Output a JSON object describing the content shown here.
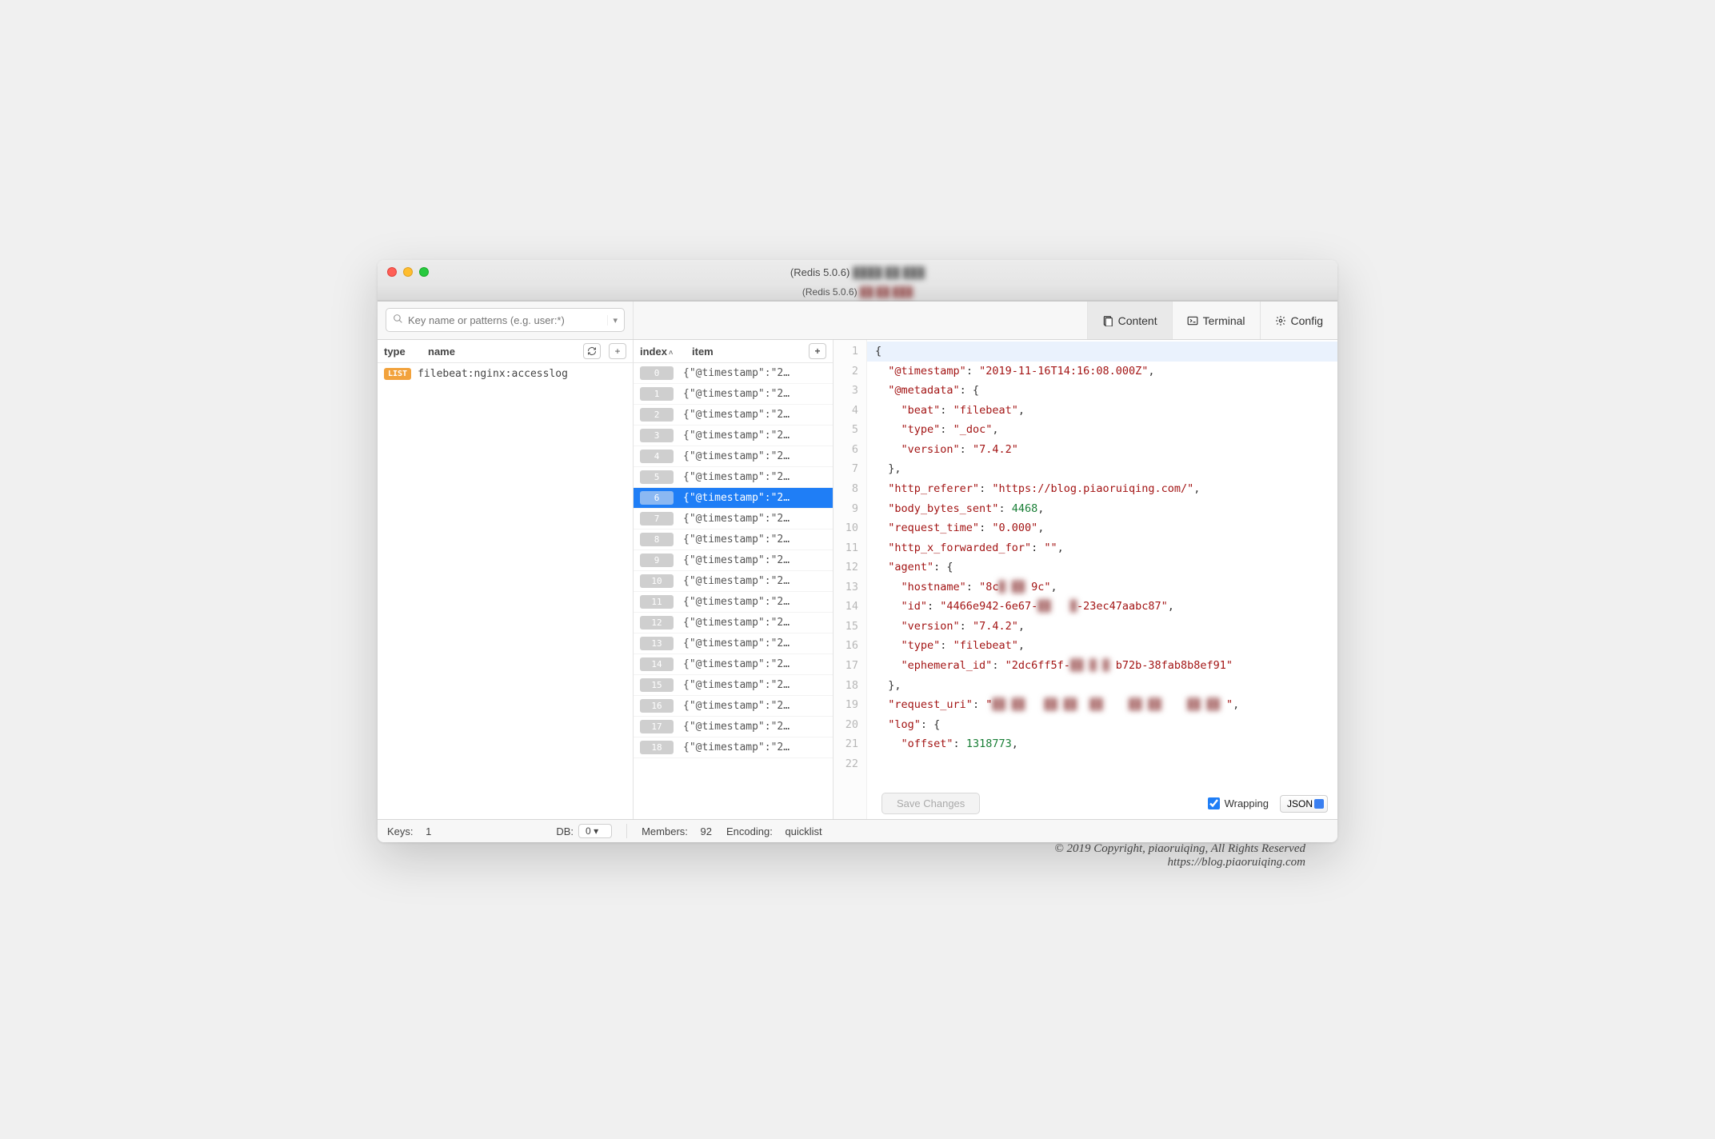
{
  "window": {
    "title_prefix": "(Redis 5.0.6) ",
    "title_redacted": "████ ██ ███",
    "subtitle_prefix": "(Redis 5.0.6) ",
    "subtitle_redacted": "██ ██ ███"
  },
  "search": {
    "placeholder": "Key name or patterns (e.g. user:*)"
  },
  "tabs": {
    "content": "Content",
    "terminal": "Terminal",
    "config": "Config"
  },
  "left": {
    "col_type": "type",
    "col_name": "name",
    "rows": [
      {
        "type": "LIST",
        "name": "filebeat:nginx:accesslog"
      }
    ]
  },
  "middle": {
    "col_index": "index",
    "col_item": "item",
    "selected_index": 6,
    "item_preview": "{\"@timestamp\":\"2…",
    "count": 19
  },
  "editor": {
    "lines": [
      {
        "n": 1,
        "html": "<span class='p'>{</span>",
        "hl": true
      },
      {
        "n": 2,
        "html": "  <span class='k'>\"@timestamp\"</span><span class='p'>: </span><span class='k'>\"2019-11-16T14:16:08.000Z\"</span><span class='p'>,</span>"
      },
      {
        "n": 3,
        "html": "  <span class='k'>\"@metadata\"</span><span class='p'>: {</span>"
      },
      {
        "n": 4,
        "html": "    <span class='k'>\"beat\"</span><span class='p'>: </span><span class='k'>\"filebeat\"</span><span class='p'>,</span>"
      },
      {
        "n": 5,
        "html": "    <span class='k'>\"type\"</span><span class='p'>: </span><span class='k'>\"_doc\"</span><span class='p'>,</span>"
      },
      {
        "n": 6,
        "html": "    <span class='k'>\"version\"</span><span class='p'>: </span><span class='k'>\"7.4.2\"</span>"
      },
      {
        "n": 7,
        "html": "  <span class='p'>},</span>"
      },
      {
        "n": 8,
        "html": "  <span class='k'>\"http_referer\"</span><span class='p'>: </span><span class='k'>\"https://blog.piaoruiqing.com/\"</span><span class='p'>,</span>"
      },
      {
        "n": 9,
        "html": "  <span class='k'>\"body_bytes_sent\"</span><span class='p'>: </span><span class='n'>4468</span><span class='p'>,</span>"
      },
      {
        "n": 10,
        "html": "  <span class='k'>\"request_time\"</span><span class='p'>: </span><span class='k'>\"0.000\"</span><span class='p'>,</span>"
      },
      {
        "n": 11,
        "html": "  <span class='k'>\"http_x_forwarded_for\"</span><span class='p'>: </span><span class='k'>\"\"</span><span class='p'>,</span>"
      },
      {
        "n": 12,
        "html": "  <span class='k'>\"agent\"</span><span class='p'>: {</span>"
      },
      {
        "n": 13,
        "html": "    <span class='k'>\"hostname\"</span><span class='p'>: </span><span class='k'>\"8c<span class='blur'>█ ██ </span>9c\"</span><span class='p'>,</span>"
      },
      {
        "n": 14,
        "html": "    <span class='k'>\"id\"</span><span class='p'>: </span><span class='k'>\"4466e942-6e67-<span class='blur'>██   █</span>-23ec47aabc87\"</span><span class='p'>,</span>"
      },
      {
        "n": 15,
        "html": "    <span class='k'>\"version\"</span><span class='p'>: </span><span class='k'>\"7.4.2\"</span><span class='p'>,</span>"
      },
      {
        "n": 16,
        "html": "    <span class='k'>\"type\"</span><span class='p'>: </span><span class='k'>\"filebeat\"</span><span class='p'>,</span>"
      },
      {
        "n": 17,
        "html": "    <span class='k'>\"ephemeral_id\"</span><span class='p'>: </span><span class='k'>\"2dc6ff5f-<span class='blur'>██ █ █ </span>b72b-38fab8b8ef91\"</span>"
      },
      {
        "n": 18,
        "html": "  <span class='p'>},</span>"
      },
      {
        "n": 19,
        "html": "  <span class='k'>\"request_uri\"</span><span class='p'>: </span><span class='k'>\"<span class='blur'>██ ██   ██ ██  ██    ██ ██    ██ ██ </span>\"</span><span class='p'>,</span>"
      },
      {
        "n": 20,
        "html": "  <span class='k'>\"log\"</span><span class='p'>: {</span>"
      },
      {
        "n": 21,
        "html": "    <span class='k'>\"offset\"</span><span class='p'>: </span><span class='n'>1318773</span><span class='p'>,</span>"
      },
      {
        "n": 22,
        "html": " "
      }
    ],
    "save_label": "Save Changes",
    "wrapping_label": "Wrapping",
    "wrapping_checked": true,
    "format": "JSON"
  },
  "status": {
    "keys_label": "Keys:",
    "keys_value": "1",
    "db_label": "DB:",
    "db_value": "0",
    "members_label": "Members:",
    "members_value": "92",
    "encoding_label": "Encoding:",
    "encoding_value": "quicklist"
  },
  "copyright": {
    "line1": "© 2019 Copyright,  piaoruiqing,  All Rights Reserved",
    "line2": "https://blog.piaoruiqing.com"
  }
}
